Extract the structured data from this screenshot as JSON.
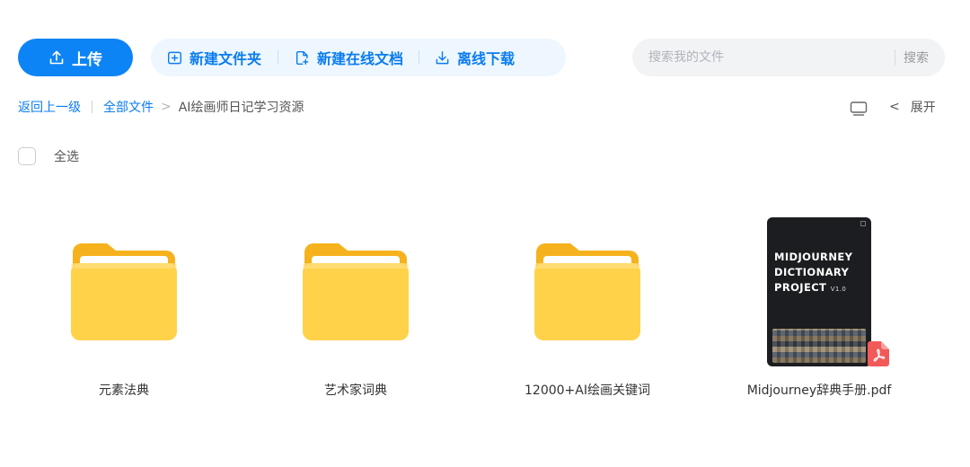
{
  "toolbar": {
    "upload_label": "上传",
    "new_folder_label": "新建文件夹",
    "new_doc_label": "新建在线文档",
    "offline_download_label": "离线下载"
  },
  "search": {
    "placeholder": "搜索我的文件",
    "button_label": "搜索"
  },
  "breadcrumb": {
    "back_label": "返回上一级",
    "all_files_label": "全部文件",
    "separator": ">",
    "current": "AI绘画师日记学习资源"
  },
  "view": {
    "expand_arrow": "<",
    "expand_label": "展开"
  },
  "select_all_label": "全选",
  "files": [
    {
      "name": "元素法典",
      "type": "folder"
    },
    {
      "name": "艺术家词典",
      "type": "folder"
    },
    {
      "name": "12000+AI绘画关键词",
      "type": "folder"
    },
    {
      "name": "Midjourney辞典手册.pdf",
      "type": "pdf"
    }
  ],
  "pdf_cover": {
    "title_line1": "MIDJOURNEY",
    "title_line2": "DICTIONARY",
    "title_line3": "PROJECT",
    "version": "V1.0"
  },
  "colors": {
    "accent": "#0d84f5",
    "accent_light_bg": "#eef7ff",
    "folder_yellow": "#ffd24a",
    "pdf_red": "#f25a5a"
  }
}
